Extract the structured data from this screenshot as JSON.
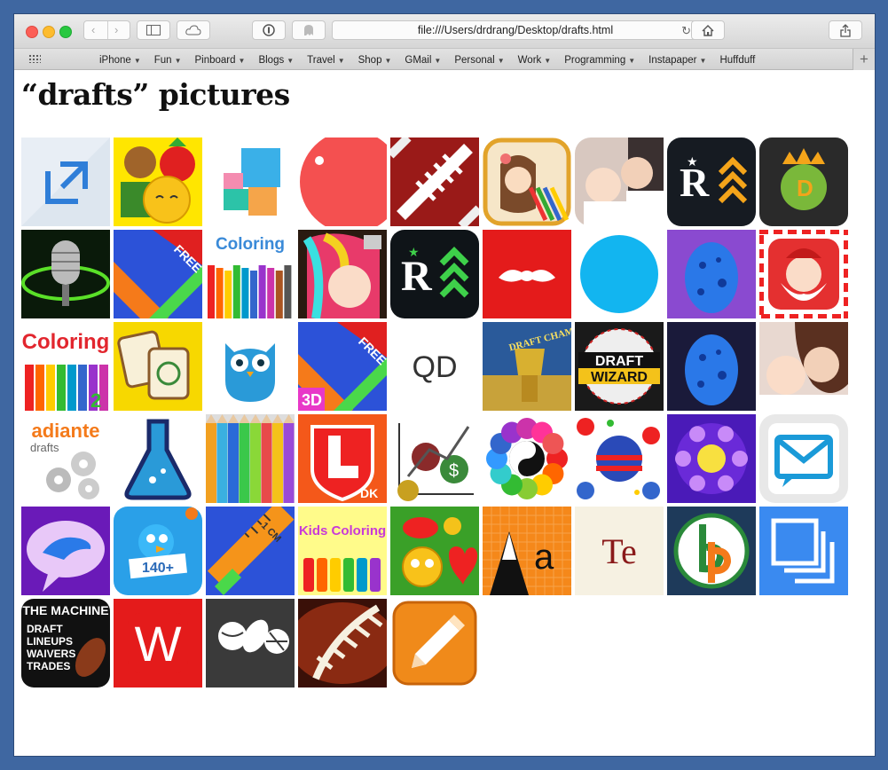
{
  "browser": {
    "address": "file:///Users/drdrang/Desktop/drafts.html",
    "favorites": [
      {
        "label": "iPhone",
        "menu": true
      },
      {
        "label": "Fun",
        "menu": true
      },
      {
        "label": "Pinboard",
        "menu": true
      },
      {
        "label": "Blogs",
        "menu": true
      },
      {
        "label": "Travel",
        "menu": true
      },
      {
        "label": "Shop",
        "menu": true
      },
      {
        "label": "GMail",
        "menu": true
      },
      {
        "label": "Personal",
        "menu": true
      },
      {
        "label": "Work",
        "menu": true
      },
      {
        "label": "Programming",
        "menu": true
      },
      {
        "label": "Instapaper",
        "menu": true
      },
      {
        "label": "Huffduff",
        "menu": false
      }
    ]
  },
  "page": {
    "title": "“drafts” pictures",
    "icons": [
      {
        "name": "drafts-arrow",
        "text": ""
      },
      {
        "name": "monkey-strawberry-emoji",
        "text": ""
      },
      {
        "name": "color-squares",
        "text": ""
      },
      {
        "name": "red-circle",
        "text": ""
      },
      {
        "name": "football-laces",
        "text": ""
      },
      {
        "name": "girl-coloring",
        "text": ""
      },
      {
        "name": "mother-baby",
        "text": ""
      },
      {
        "name": "r-chevrons-dark",
        "text": ""
      },
      {
        "name": "draftkings-crown",
        "text": ""
      },
      {
        "name": "microphone",
        "text": ""
      },
      {
        "name": "ruler-free",
        "text": "FREE"
      },
      {
        "name": "coloring-pencils",
        "text": "Coloring"
      },
      {
        "name": "girl-hair-colors",
        "text": ""
      },
      {
        "name": "r-chevrons-black",
        "text": ""
      },
      {
        "name": "red-mustache",
        "text": ""
      },
      {
        "name": "blue-circle",
        "text": ""
      },
      {
        "name": "blue-egg-purple",
        "text": ""
      },
      {
        "name": "santa",
        "text": ""
      },
      {
        "name": "coloring-2",
        "text": "Coloring"
      },
      {
        "name": "mahjong-tiles",
        "text": ""
      },
      {
        "name": "blue-owl",
        "text": ""
      },
      {
        "name": "ruler-free-3d",
        "text": "FREE"
      },
      {
        "name": "qd-logo",
        "text": "QD"
      },
      {
        "name": "draft-champ-trophy",
        "text": "DRAFT CHAMP"
      },
      {
        "name": "draft-wizard",
        "text": "DRAFT WIZARD"
      },
      {
        "name": "blue-egg-dark",
        "text": ""
      },
      {
        "name": "baby-mother-2",
        "text": ""
      },
      {
        "name": "adiante-drafts",
        "text": "adiante"
      },
      {
        "name": "flask",
        "text": ""
      },
      {
        "name": "colored-pencils",
        "text": ""
      },
      {
        "name": "draftkings-lineup",
        "text": "DK"
      },
      {
        "name": "football-gears",
        "text": ""
      },
      {
        "name": "yin-yang-flower",
        "text": ""
      },
      {
        "name": "flags-dots",
        "text": ""
      },
      {
        "name": "purple-sun-dots",
        "text": ""
      },
      {
        "name": "mail-envelope",
        "text": ""
      },
      {
        "name": "bird-speech",
        "text": ""
      },
      {
        "name": "bird-140",
        "text": "140+"
      },
      {
        "name": "ruler-cm",
        "text": "1 CM"
      },
      {
        "name": "kids-coloring",
        "text": "Kids Coloring"
      },
      {
        "name": "emoji-lips-heart",
        "text": ""
      },
      {
        "name": "letter-a",
        "text": "Aa"
      },
      {
        "name": "te-text",
        "text": "Te"
      },
      {
        "name": "bp-logo",
        "text": ""
      },
      {
        "name": "stacked-squares",
        "text": ""
      },
      {
        "name": "the-machine",
        "text": "THE MACHINE DRAFT LINEUPS WAIVERS TRADES"
      },
      {
        "name": "w-logo",
        "text": "W"
      },
      {
        "name": "sports-balls",
        "text": ""
      },
      {
        "name": "football-closeup",
        "text": ""
      },
      {
        "name": "pencil-orange",
        "text": ""
      }
    ]
  }
}
